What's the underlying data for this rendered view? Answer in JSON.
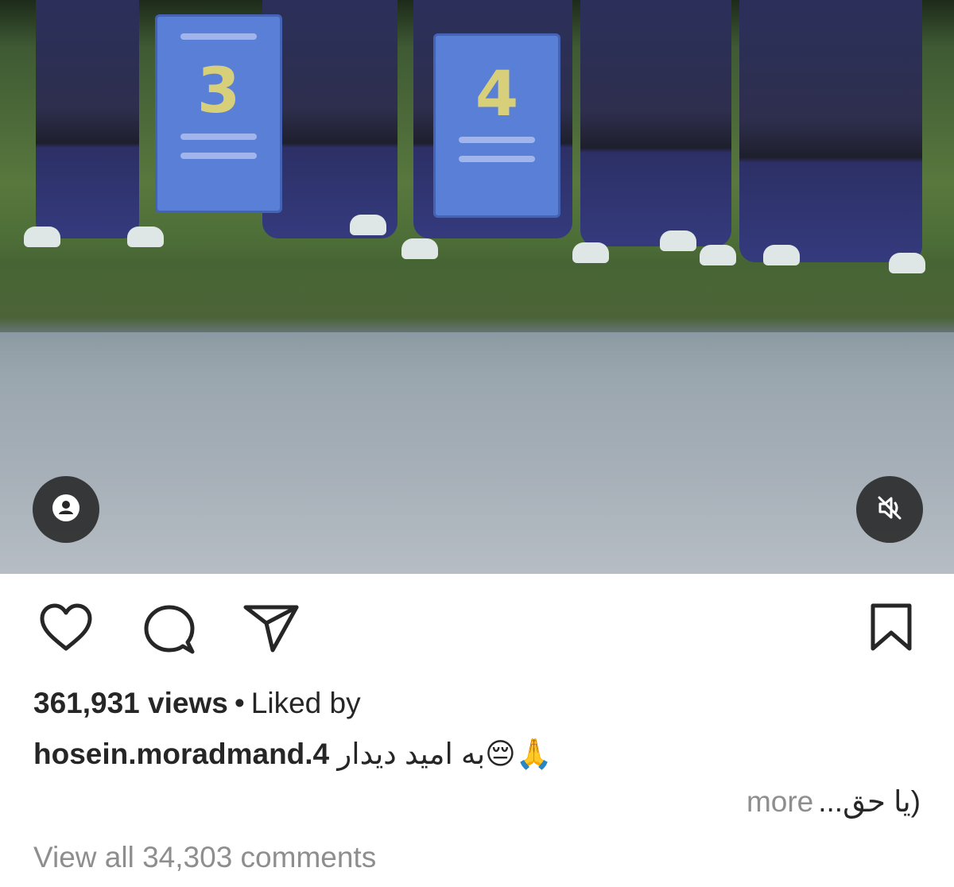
{
  "media": {
    "jersey_left_number": "3",
    "jersey_right_number": "4",
    "mute_state": "muted"
  },
  "post": {
    "views": "361,931 views",
    "separator": "•",
    "liked_by": "Liked by",
    "username": "hosein.moradmand.4",
    "caption_text": "به امید دیدار",
    "caption_emojis": "😔🙏",
    "caption_second_line": "(یا حق",
    "ellipsis": "...",
    "more_label": "more",
    "view_comments": "View all 34,303 comments"
  },
  "icons": {
    "like": "heart-icon",
    "comment": "comment-bubble-icon",
    "share": "paper-plane-icon",
    "save": "bookmark-icon",
    "tags": "user-tag-icon",
    "mute": "speaker-muted-icon"
  },
  "colors": {
    "text_primary": "#262626",
    "text_secondary": "#8e8e8e",
    "media_button_bg": "#262626"
  }
}
